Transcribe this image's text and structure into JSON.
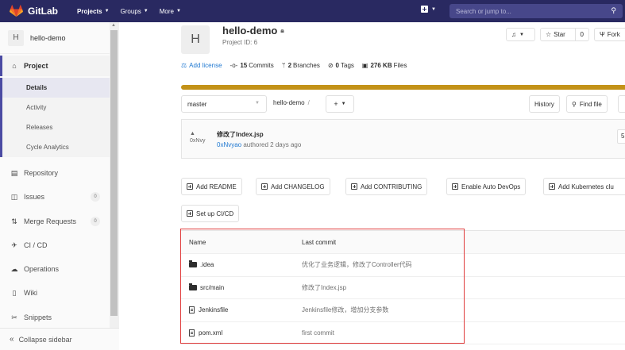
{
  "topnav": {
    "brand": "GitLab",
    "menu": [
      {
        "label": "Projects"
      },
      {
        "label": "Groups"
      },
      {
        "label": "More"
      }
    ],
    "search_placeholder": "Search or jump to..."
  },
  "sidebar": {
    "project_initial": "H",
    "project_name": "hello-demo",
    "project_label": "Project",
    "sub_items": [
      "Details",
      "Activity",
      "Releases",
      "Cycle Analytics"
    ],
    "items": [
      {
        "label": "Repository",
        "icon": "book-icon"
      },
      {
        "label": "Issues",
        "icon": "issues-icon",
        "count": "0"
      },
      {
        "label": "Merge Requests",
        "icon": "merge-request-icon",
        "count": "0"
      },
      {
        "label": "CI / CD",
        "icon": "rocket-icon"
      },
      {
        "label": "Operations",
        "icon": "cloud-gear-icon"
      },
      {
        "label": "Wiki",
        "icon": "wiki-icon"
      },
      {
        "label": "Snippets",
        "icon": "scissors-icon"
      }
    ],
    "collapse_label": "Collapse sidebar"
  },
  "project": {
    "initial": "H",
    "title": "hello-demo",
    "id_label": "Project ID: 6",
    "notify_icon": "bell-icon",
    "star_label": "Star",
    "star_count": "0",
    "fork_label": "Fork"
  },
  "stats": {
    "add_license": "Add license",
    "commits_count": "15",
    "commits_label": "Commits",
    "branches_count": "2",
    "branches_label": "Branches",
    "tags_count": "0",
    "tags_label": "Tags",
    "files_size": "276 KB",
    "files_label": "Files"
  },
  "repo_nav": {
    "branch": "master",
    "path_root": "hello-demo",
    "path_sep": "/",
    "history_label": "History",
    "find_file_label": "Find file"
  },
  "last_commit": {
    "avatar_alt": "0xNvy",
    "title": "修改了Index.jsp",
    "author": "0xNvyao",
    "meta": "authored 2 days ago",
    "sha_stub": "5"
  },
  "quick_actions": [
    "Add README",
    "Add CHANGELOG",
    "Add CONTRIBUTING",
    "Enable Auto DevOps",
    "Add Kubernetes clu",
    "Set up CI/CD"
  ],
  "tree": {
    "headers": {
      "name": "Name",
      "last_commit": "Last commit"
    },
    "rows": [
      {
        "type": "folder",
        "name": ".idea",
        "commit": "优化了业务逻辑，修改了Controller代码"
      },
      {
        "type": "folder",
        "name": "src/main",
        "commit": "修改了Index.jsp"
      },
      {
        "type": "file",
        "name": "Jenkinsfile",
        "commit": "Jenkinsfile修改，增加分支参数"
      },
      {
        "type": "file",
        "name": "pom.xml",
        "commit": "first commit"
      }
    ]
  },
  "colors": {
    "topnav_bg": "#292961",
    "accent": "#4b4ba3",
    "progress_bar": "#c39218",
    "link": "#1f78d1",
    "highlight_box": "#e03c3c"
  }
}
